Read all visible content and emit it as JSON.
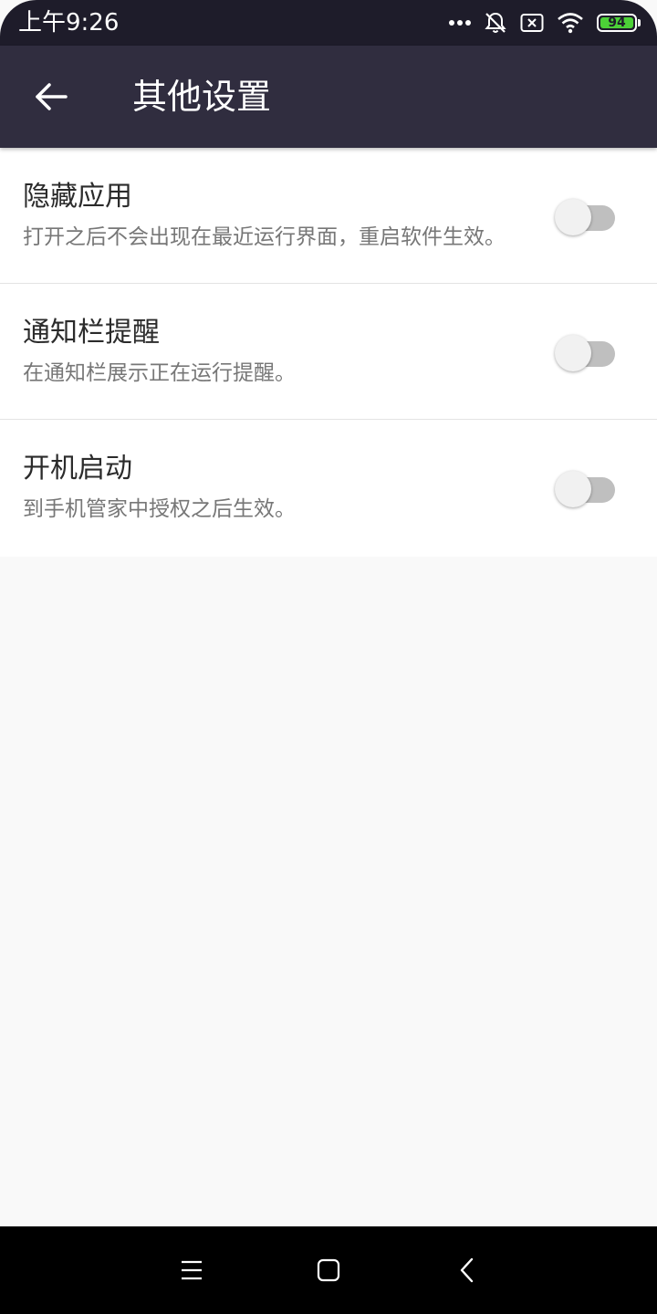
{
  "status_bar": {
    "time": "上午9:26",
    "battery_level": "94",
    "icons": [
      "more-dots-icon",
      "bell-muted-icon",
      "sim-no-signal-icon",
      "wifi-icon",
      "battery-icon"
    ]
  },
  "toolbar": {
    "back_icon": "arrow-left-icon",
    "title": "其他设置"
  },
  "settings": [
    {
      "title": "隐藏应用",
      "description": "打开之后不会出现在最近运行界面，重启软件生效。",
      "enabled": false
    },
    {
      "title": "通知栏提醒",
      "description": "在通知栏展示正在运行提醒。",
      "enabled": false
    },
    {
      "title": "开机启动",
      "description": "到手机管家中授权之后生效。",
      "enabled": false
    }
  ],
  "nav_bar": {
    "icons": [
      "menu-icon",
      "home-icon",
      "back-icon"
    ]
  },
  "colors": {
    "status_bar_bg": "#1e1c2a",
    "toolbar_bg": "#302d3f",
    "page_bg": "#f9f9f9",
    "battery_green": "#4cd137",
    "toggle_off_track": "#bfbfbf"
  }
}
